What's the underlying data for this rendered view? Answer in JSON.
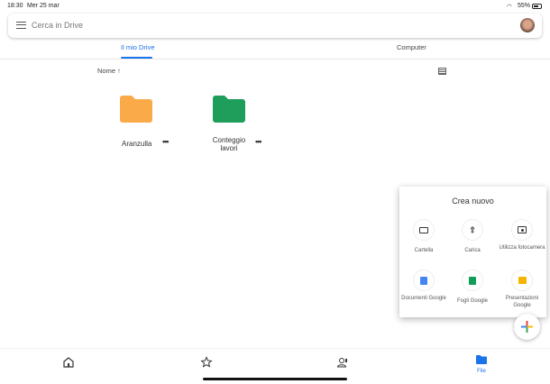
{
  "status": {
    "time": "18:30",
    "date": "Mer 25 mar",
    "battery": "55%"
  },
  "search": {
    "placeholder": "Cerca in Drive"
  },
  "tabs": [
    {
      "label": "Il mio Drive",
      "active": true
    },
    {
      "label": "Computer",
      "active": false
    }
  ],
  "sort": {
    "label": "Nome ↑"
  },
  "folders": [
    {
      "name": "Aranzulla",
      "color": "#fbaa4a"
    },
    {
      "name": "Conteggio lavori",
      "color": "#1e9e5a"
    }
  ],
  "create_menu": {
    "title": "Crea nuovo",
    "options": [
      {
        "label": "Cartella"
      },
      {
        "label": "Carica"
      },
      {
        "label": "Utilizza fotocamera"
      },
      {
        "label": "Documenti Google"
      },
      {
        "label": "Fogli Google"
      },
      {
        "label": "Presentazioni Google"
      }
    ]
  },
  "bottom_nav": {
    "file_label": "File"
  },
  "colors": {
    "accent": "#1a73e8"
  }
}
